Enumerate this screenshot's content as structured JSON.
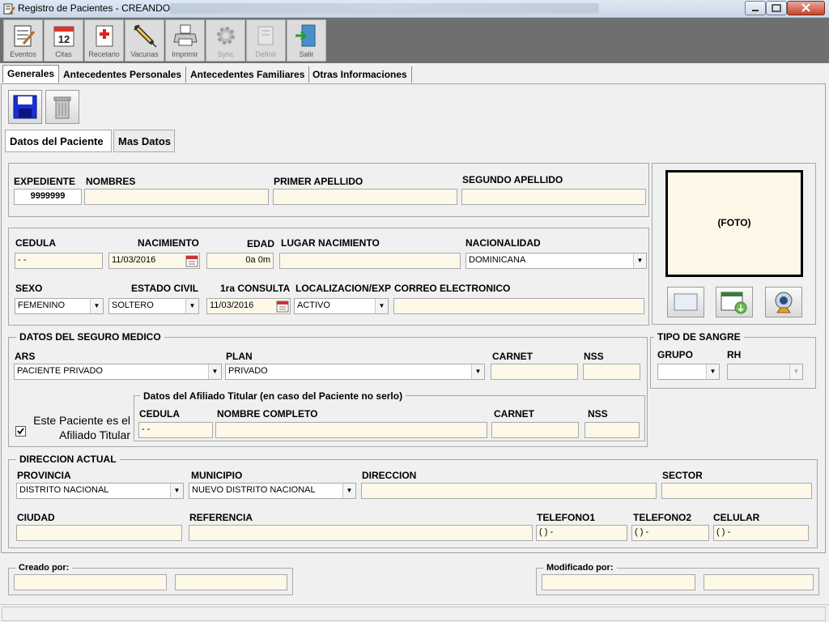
{
  "window": {
    "title": "Registro de Pacientes - CREANDO"
  },
  "toolbar": [
    {
      "label": "Eventos",
      "icon": "notepad-icon",
      "enabled": true
    },
    {
      "label": "Citas",
      "icon": "calendar-icon",
      "enabled": true
    },
    {
      "label": "Recetario",
      "icon": "prescription-icon",
      "enabled": true
    },
    {
      "label": "Vacunas",
      "icon": "syringe-icon",
      "enabled": true
    },
    {
      "label": "Imprimir",
      "icon": "printer-icon",
      "enabled": true
    },
    {
      "label": "Sync",
      "icon": "sync-gear-icon",
      "enabled": false
    },
    {
      "label": "Definir",
      "icon": "define-icon",
      "enabled": false
    },
    {
      "label": "Salir",
      "icon": "exit-door-icon",
      "enabled": true
    }
  ],
  "main_tabs": [
    "Generales",
    "Antecedentes Personales",
    "Antecedentes Familiares",
    "Otras Informaciones"
  ],
  "sub_tabs": [
    "Datos del Paciente",
    "Mas Datos"
  ],
  "patient": {
    "labels": {
      "expediente": "EXPEDIENTE",
      "nombres": "NOMBRES",
      "primer_apellido": "PRIMER APELLIDO",
      "segundo_apellido": "SEGUNDO APELLIDO"
    },
    "expediente": "9999999",
    "nombres": "",
    "primer_apellido": "",
    "segundo_apellido": ""
  },
  "personal": {
    "labels": {
      "cedula": "CEDULA",
      "nacimiento": "NACIMIENTO",
      "edad": "EDAD",
      "lugar_nacimiento": "LUGAR NACIMIENTO",
      "nacionalidad": "NACIONALIDAD",
      "sexo": "SEXO",
      "estado_civil": "ESTADO CIVIL",
      "primera_consulta": "1ra CONSULTA",
      "localizacion": "LOCALIZACION/EXP",
      "correo": "CORREO ELECTRONICO"
    },
    "cedula": "   -       -",
    "nacimiento": "11/03/2016",
    "edad": "0a  0m",
    "lugar_nacimiento": "",
    "nacionalidad": "DOMINICANA",
    "sexo": "FEMENINO",
    "estado_civil": "SOLTERO",
    "primera_consulta": "11/03/2016",
    "localizacion": "ACTIVO",
    "correo": ""
  },
  "foto": {
    "label": "(FOTO)"
  },
  "seguro": {
    "title": "DATOS DEL SEGURO MEDICO",
    "labels": {
      "ars": "ARS",
      "plan": "PLAN",
      "carnet": "CARNET",
      "nss": "NSS"
    },
    "ars": "PACIENTE PRIVADO",
    "plan": "PRIVADO",
    "carnet": "",
    "nss": "",
    "afiliado_checkbox": "Este Paciente es el Afiliado Titular",
    "afiliado_checked": true,
    "titular": {
      "title": "Datos del Afiliado Titular (en caso del Paciente no serlo)",
      "labels": {
        "cedula": "CEDULA",
        "nombre": "NOMBRE COMPLETO",
        "carnet": "CARNET",
        "nss": "NSS"
      },
      "cedula": "   -       -",
      "nombre": "",
      "carnet": "",
      "nss": ""
    }
  },
  "sangre": {
    "title": "TIPO DE SANGRE",
    "labels": {
      "grupo": "GRUPO",
      "rh": "RH"
    },
    "grupo": "",
    "rh": ""
  },
  "direccion": {
    "title": "DIRECCION ACTUAL",
    "labels": {
      "provincia": "PROVINCIA",
      "municipio": "MUNICIPIO",
      "direccion": "DIRECCION",
      "sector": "SECTOR",
      "ciudad": "CIUDAD",
      "referencia": "REFERENCIA",
      "telefono1": "TELEFONO1",
      "telefono2": "TELEFONO2",
      "celular": "CELULAR"
    },
    "provincia": "DISTRITO NACIONAL",
    "municipio": "NUEVO DISTRITO NACIONAL",
    "direccion": "",
    "sector": "",
    "ciudad": "",
    "referencia": "",
    "telefono1": "(   )    -",
    "telefono2": "(   )    -",
    "celular": "(   )    -"
  },
  "audit": {
    "creado_label": "Creado por:",
    "modificado_label": "Modificado por:",
    "creado_user": "",
    "creado_fecha": "",
    "modificado_user": "",
    "modificado_fecha": ""
  }
}
